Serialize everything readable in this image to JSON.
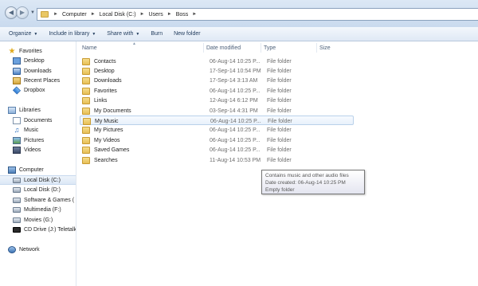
{
  "breadcrumb": {
    "items": [
      "Computer",
      "Local Disk (C:)",
      "Users",
      "Boss"
    ]
  },
  "toolbar": {
    "organize": "Organize",
    "include_in_library": "Include in library",
    "share_with": "Share with",
    "burn": "Burn",
    "new_folder": "New folder"
  },
  "nav": {
    "favorites": {
      "label": "Favorites",
      "items": [
        "Desktop",
        "Downloads",
        "Recent Places",
        "Dropbox"
      ]
    },
    "libraries": {
      "label": "Libraries",
      "items": [
        "Documents",
        "Music",
        "Pictures",
        "Videos"
      ]
    },
    "computer": {
      "label": "Computer",
      "items": [
        "Local Disk (C:)",
        "Local Disk (D:)",
        "Software & Games (",
        "Multimedia (F:)",
        "Movies (G:)",
        "CD Drive (J:) Teletalk"
      ],
      "selected": "Local Disk (C:)"
    },
    "network": {
      "label": "Network"
    }
  },
  "columns": {
    "name": "Name",
    "date_modified": "Date modified",
    "type": "Type",
    "size": "Size"
  },
  "files": [
    {
      "name": "Contacts",
      "date": "06-Aug-14 10:25 P...",
      "type": "File folder"
    },
    {
      "name": "Desktop",
      "date": "17-Sep-14 10:54 PM",
      "type": "File folder"
    },
    {
      "name": "Downloads",
      "date": "17-Sep-14 3:13 AM",
      "type": "File folder"
    },
    {
      "name": "Favorites",
      "date": "06-Aug-14 10:25 P...",
      "type": "File folder"
    },
    {
      "name": "Links",
      "date": "12-Aug-14 6:12 PM",
      "type": "File folder"
    },
    {
      "name": "My Documents",
      "date": "03-Sep-14 4:31 PM",
      "type": "File folder"
    },
    {
      "name": "My Music",
      "date": "06-Aug-14 10:25 P...",
      "type": "File folder"
    },
    {
      "name": "My Pictures",
      "date": "06-Aug-14 10:25 P...",
      "type": "File folder"
    },
    {
      "name": "My Videos",
      "date": "06-Aug-14 10:25 P...",
      "type": "File folder"
    },
    {
      "name": "Saved Games",
      "date": "06-Aug-14 10:25 P...",
      "type": "File folder"
    },
    {
      "name": "Searches",
      "date": "11-Aug-14 10:53 PM",
      "type": "File folder"
    }
  ],
  "hovered_file": "My Music",
  "tooltip": {
    "line1": "Contains music and other audio files",
    "line2": "Date created: 06-Aug-14 10:25 PM",
    "line3": "Empty folder"
  },
  "colors": {
    "address_bar_bg": "#dce8f5",
    "command_bar_text": "#1e395b",
    "folder_yellow": "#e6bf55",
    "selection_border": "#b9d1ea"
  }
}
